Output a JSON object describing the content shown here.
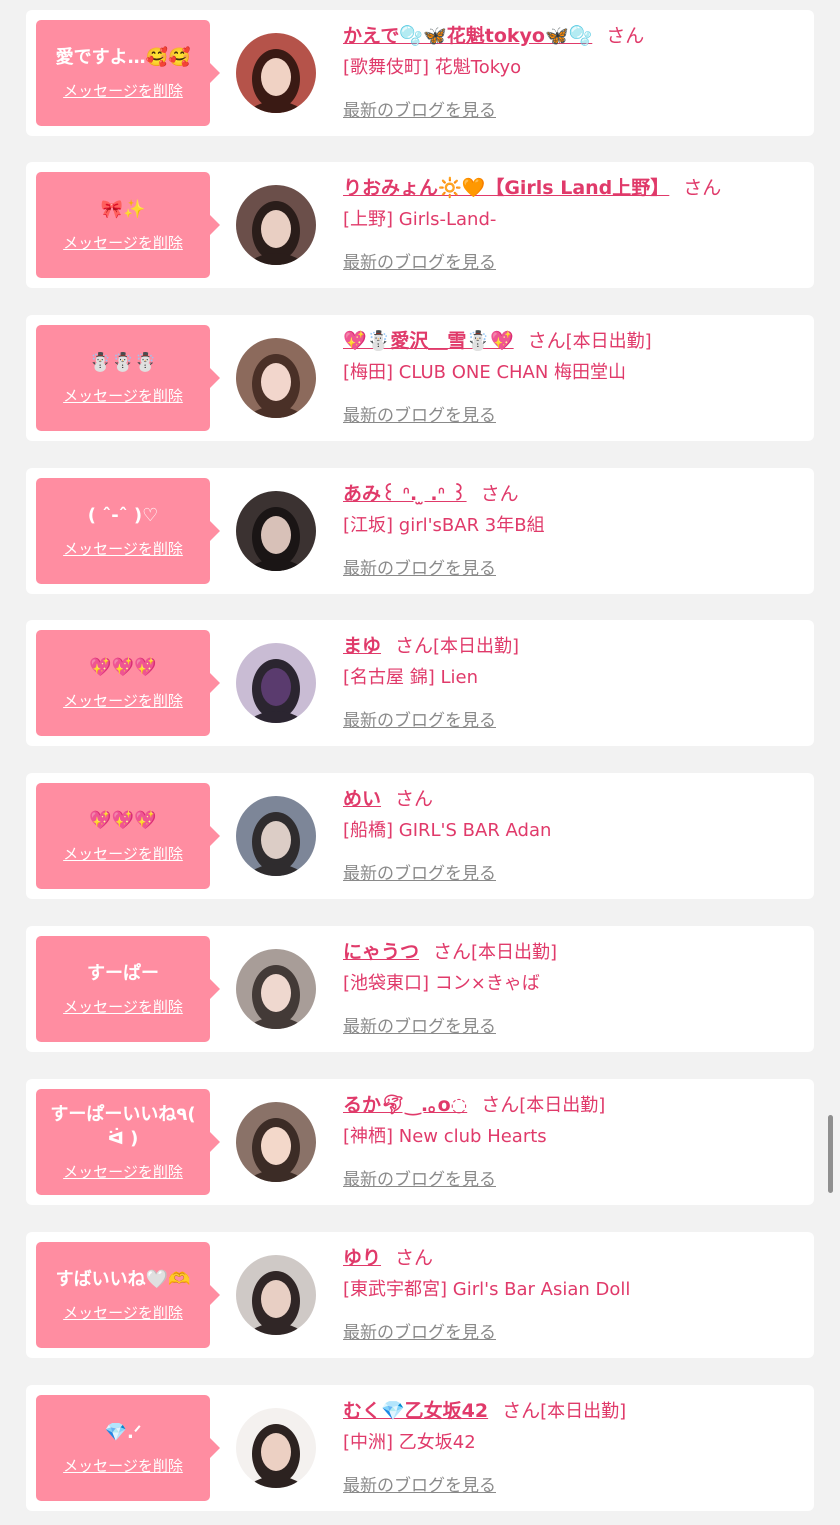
{
  "labels": {
    "delete": "メッセージを削除",
    "san": "さん",
    "blog": "最新のブログを見る"
  },
  "entries": [
    {
      "message": "愛ですよ…🥰🥰",
      "name": "かえで🫧🦋花魁tokyo🦋🫧",
      "status": "",
      "shop": "[歌舞伎町] 花魁Tokyo",
      "avatar_colors": [
        "#b5534a",
        "#f0d2c4",
        "#3a1a14"
      ]
    },
    {
      "message": "🎀✨",
      "name": "りおみょん🔆🧡【Girls Land上野】",
      "status": "",
      "shop": "[上野] Girls-Land-",
      "avatar_colors": [
        "#6b4f4a",
        "#e9cfc3",
        "#2a1d1a"
      ]
    },
    {
      "message": "☃️☃️☃️",
      "name": "💖☃️愛沢＿雪☃️💖",
      "status": "[本日出勤]",
      "shop": "[梅田] CLUB ONE CHAN 梅田堂山",
      "avatar_colors": [
        "#8c6a5c",
        "#f2d6cc",
        "#4a3027"
      ]
    },
    {
      "message": "( ˆ-ˆ )♡",
      "name": "あみ꒰ ᐢ. ̫ .ᐢ ꒱",
      "status": "",
      "shop": "[江坂] girl'sBAR 3年B組",
      "avatar_colors": [
        "#3b3231",
        "#d8c1b8",
        "#1a1515"
      ]
    },
    {
      "message": "💖💖💖",
      "name": "まゆ",
      "status": "[本日出勤]",
      "shop": "[名古屋 錦] Lien",
      "avatar_colors": [
        "#c9bcd4",
        "#5a3b6e",
        "#2b2530"
      ]
    },
    {
      "message": "💖💖💖",
      "name": "めい",
      "status": "",
      "shop": "[船橋] GIRL'S BAR Adan",
      "avatar_colors": [
        "#7d8698",
        "#dccdc6",
        "#2f2c2e"
      ]
    },
    {
      "message": "すーぱー",
      "name": "にゃうつ",
      "status": "[本日出勤]",
      "shop": "[池袋東口] コン×きゃば",
      "avatar_colors": [
        "#a89d98",
        "#efd8cf",
        "#433a37"
      ]
    },
    {
      "message": "すーぱーいいね٩( ᐛ )",
      "name": "るか🐬︎‿︎.｡o◌",
      "status": "[本日出勤]",
      "shop": "[神栖] New club Hearts",
      "avatar_colors": [
        "#8a7268",
        "#f3d8ca",
        "#3c2c26"
      ]
    },
    {
      "message": "すばいいね🤍🫶",
      "name": "ゆり",
      "status": "",
      "shop": "[東武宇都宮] Girl's Bar Asian Doll",
      "avatar_colors": [
        "#cfc9c6",
        "#e8cfc4",
        "#302626"
      ]
    },
    {
      "message": "💎.ᐟ",
      "name": "むく💎乙女坂42",
      "status": "[本日出勤]",
      "shop": "[中洲] 乙女坂42",
      "avatar_colors": [
        "#f4f1ef",
        "#ecd0c3",
        "#2c2220"
      ]
    }
  ]
}
